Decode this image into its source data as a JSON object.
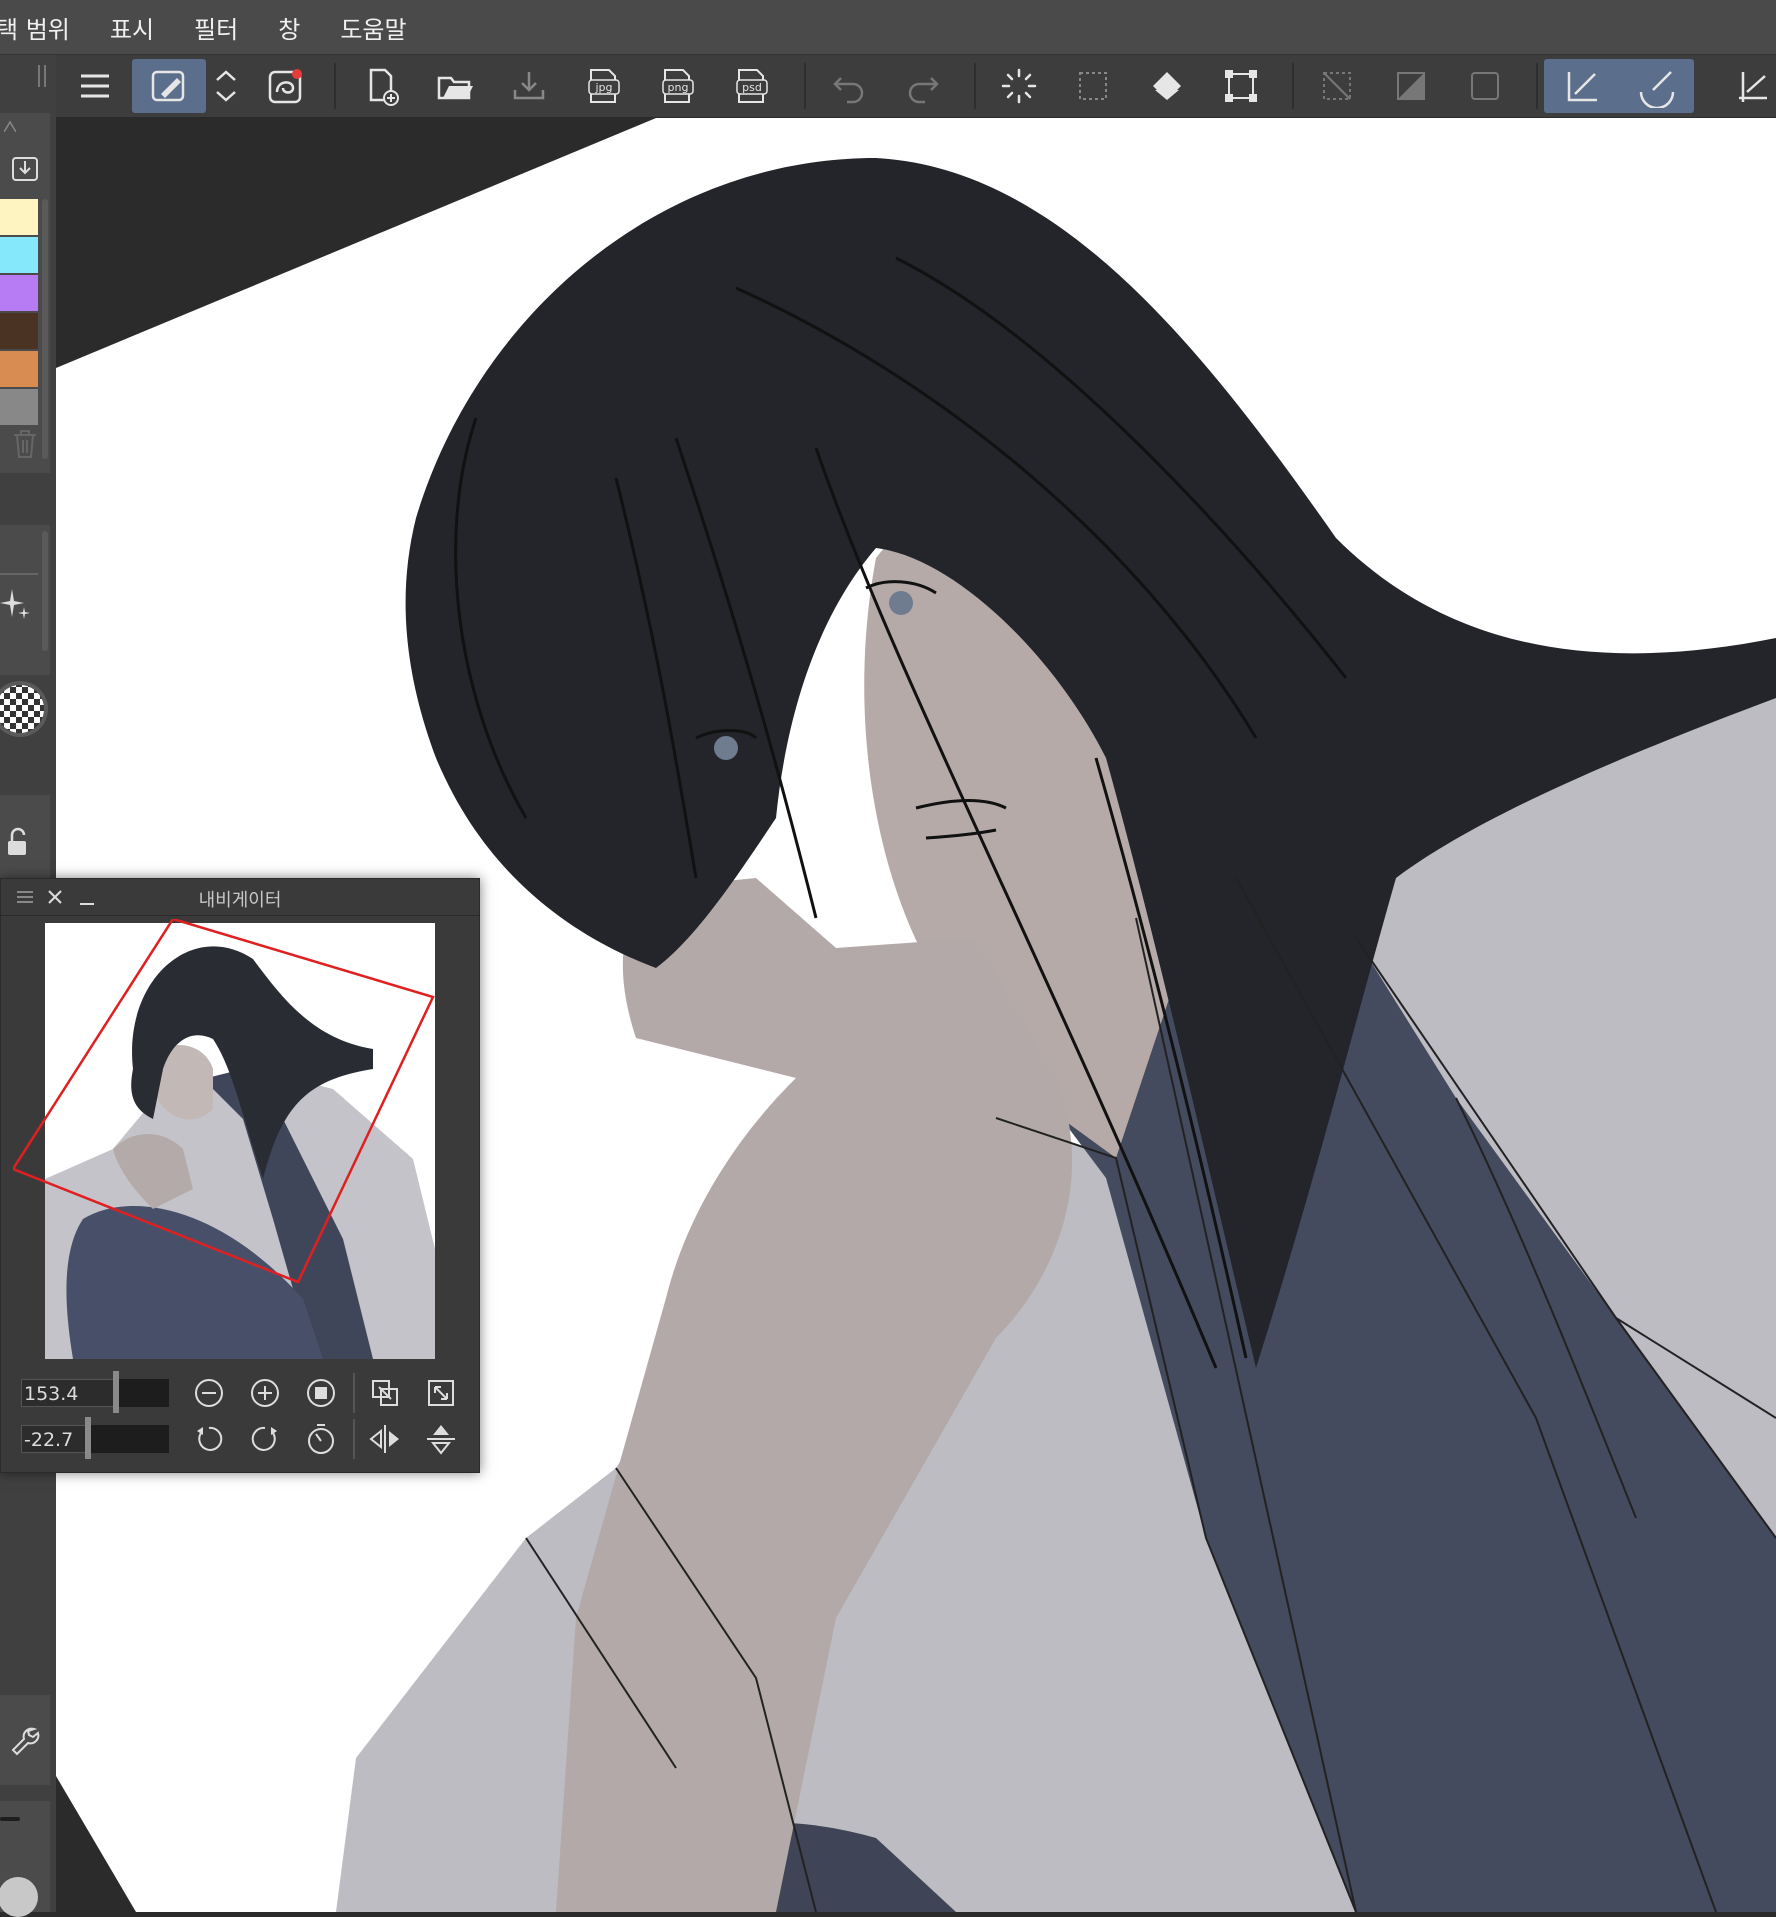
{
  "menubar": {
    "items": [
      "택 범위",
      "표시",
      "필터",
      "창",
      "도움말"
    ]
  },
  "toolbar": {
    "file_type_labels": {
      "jpg": "jpg",
      "png": "png",
      "psd": "psd"
    }
  },
  "navigator": {
    "title": "내비게이터",
    "zoom_value": "153.4",
    "rotation_value": "-22.7"
  },
  "palette": {
    "swatch_colors": [
      "#fdf4c2",
      "#86e8fb",
      "#b77bf4",
      "#4a3322",
      "#d98c52",
      "#888888"
    ]
  },
  "colors": {
    "active_tool": "#5b6e8c",
    "kimono_dark": "#454b5e",
    "kimono_light": "#bcbcc2",
    "skin": "#b5aaa8",
    "hair": "#23252b"
  }
}
